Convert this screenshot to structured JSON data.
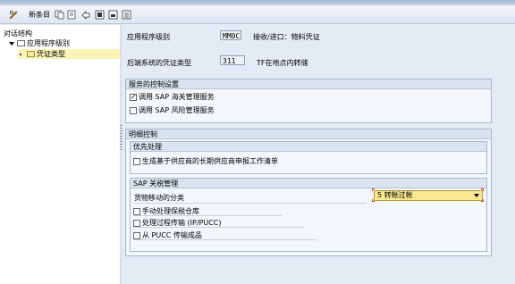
{
  "toolbar": {
    "new_entries_label": "新条目"
  },
  "tree": {
    "header": "对话结构",
    "items": [
      {
        "label": "应用程序级别"
      },
      {
        "label": "凭证类型"
      }
    ]
  },
  "main": {
    "app_level_label": "应用程序级别",
    "app_level_value": "MM0C",
    "app_level_desc": "接收/进口：物料凭证",
    "followup_doc_label": "后端系统的凭证类型",
    "followup_doc_value": "311",
    "followup_doc_desc": "TF在地点内转储",
    "service_control": {
      "title": "服务的控制设置",
      "checkboxes": [
        {
          "label": "调用 SAP 海关管理服务",
          "checked": true,
          "mark": "✓"
        },
        {
          "label": "调用 SAP 风险管理服务",
          "checked": false,
          "mark": ""
        }
      ]
    },
    "detail_control": {
      "title": "明细控制",
      "priority": {
        "title": "优先处理",
        "checkbox_label": "生成基于供应商的长期供应商申报工作清单"
      },
      "gts": {
        "title": "SAP 关税管理",
        "movement_label": "货物移动的分类",
        "movement_value": "5 转帐过帐",
        "checkboxes": [
          {
            "label": "手动处理保税仓库"
          },
          {
            "label": "处理过程传输 (IP/PUCC)"
          },
          {
            "label": "从 PUCC 传输成品"
          }
        ]
      }
    }
  }
}
